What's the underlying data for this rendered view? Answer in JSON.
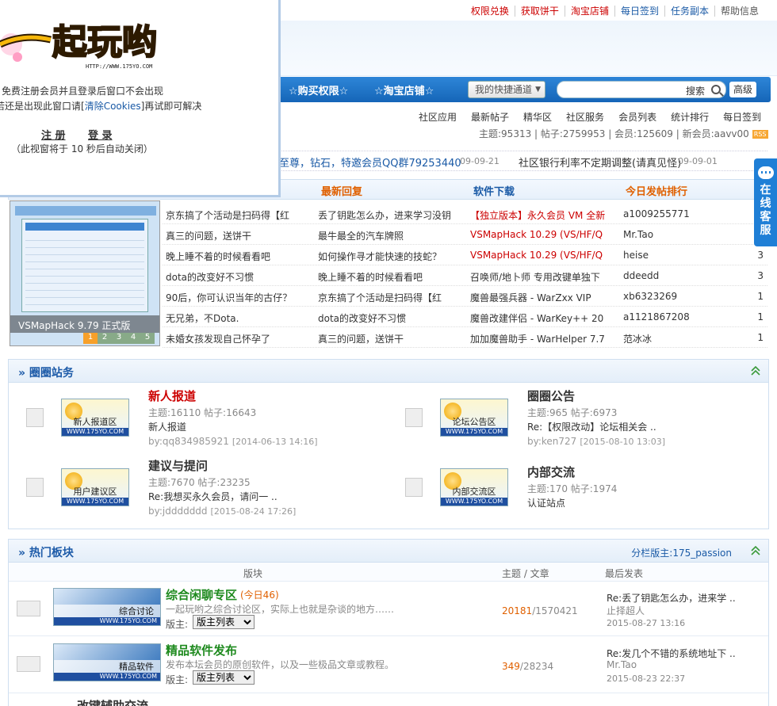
{
  "top_links": [
    {
      "label": "权限兑换",
      "color": "#cc0000"
    },
    {
      "label": "获取饼干",
      "color": "#cc0000"
    },
    {
      "label": "淘宝店铺",
      "color": "#cc0000"
    },
    {
      "label": "每日签到",
      "color": "#1a5aa6"
    },
    {
      "label": "任务副本",
      "color": "#1a5aa6"
    },
    {
      "label": "帮助信息",
      "color": "#555555"
    }
  ],
  "popup": {
    "logo_text": "一起玩哟",
    "logo_url": "HTTP://WWW.175YO.COM",
    "line1": "免费注册会员并且登录后窗口不会出现",
    "line2_pre": "若还是出现此窗口请[",
    "line2_link": "清除Cookies",
    "line2_post": "]再试即可解决",
    "register": "注 册",
    "login": "登 录",
    "countdown": "（此视窗将于 10 秒后自动关闭）"
  },
  "nav": {
    "link1": "☆购买权限☆",
    "link2": "☆淘宝店铺☆",
    "quick": "我的快捷通道",
    "search_label": "搜索",
    "advanced": "高级"
  },
  "community_links": [
    "社区应用",
    "最新帖子",
    "精华区",
    "社区服务",
    "会员列表",
    "统计排行",
    "每日签到"
  ],
  "stats": {
    "text": "主题:95313 | 帖子:2759953 | 会员:125609 | 新会员:aavv00",
    "rss": "RSS"
  },
  "announcements": [
    {
      "text": "至尊，钻石，特邀会员QQ群79253440",
      "date": "09-09-21"
    },
    {
      "text": "社区银行利率不定期调整(请真见怪)",
      "date": "09-09-01"
    }
  ],
  "four_cols": {
    "headers": [
      {
        "label": "最新回复",
        "color": "#e06000"
      },
      {
        "label": "软件下载",
        "color": "#1a5aa6"
      },
      {
        "label": "今日发帖排行",
        "color": "#e06000"
      }
    ],
    "screenshot_caption": "VSMapHack 9.79 正式版",
    "screenshot_pages": [
      "1",
      "2",
      "3",
      "4",
      "5"
    ],
    "rows": [
      {
        "c1": "京东搞了个活动是扫码得【红",
        "c2": "丢了钥匙怎么办，进来学习没钥",
        "c3": "【独立版本】永久会员 VM 全新",
        "c3red": true,
        "c4": "a1009255771",
        "c5": ""
      },
      {
        "c1": "真三的问题，送饼干",
        "c2": "最牛最全的汽车牌照",
        "c3": "VSMapHack 10.29 (VS/HF/Q",
        "c3red": true,
        "c4": "Mr.Tao",
        "c5": "3"
      },
      {
        "c1": "晚上睡不着的时候看看吧",
        "c2": "如何操作寻才能快速的技蛇？",
        "c3": "VSMapHack 10.29 (VS/HF/Q",
        "c3red": true,
        "c4": "heise",
        "c5": "3"
      },
      {
        "c1": "dota的改变好不习惯",
        "c2": "晚上睡不着的时候看看吧",
        "c3": "召唤师/地卜师 专用改键单独下",
        "c3red": false,
        "c4": "ddeedd",
        "c5": "3"
      },
      {
        "c1": "90后，你可认识当年的古仔？",
        "c2": "京东搞了个活动是扫码得【红",
        "c3": "魔兽最强兵器 - WarZxx VIP",
        "c3red": false,
        "c4": "xb6323269",
        "c5": "1"
      },
      {
        "c1": "无兄弟，不Dota.",
        "c2": "dota的改变好不习惯",
        "c3": "魔兽改建伴侣 - WarKey++ 20",
        "c3red": false,
        "c4": "a1121867208",
        "c5": "1"
      },
      {
        "c1": "未婚女孩发现自己怀孕了",
        "c2": "真三的问题，送饼干",
        "c3": "加加魔兽助手 - WarHelper 7.7",
        "c3red": false,
        "c4": "范冰冰",
        "c5": "1"
      }
    ]
  },
  "section1": {
    "title": "» 圈圈站务",
    "forums": [
      {
        "name": "新人报道",
        "name_color": "#cc0000",
        "thumb": "新人报道区",
        "meta": "主题:16110  帖子:16643",
        "desc": "新人报道",
        "by": "by:qq834985921",
        "date": "[2014-06-13 14:16]"
      },
      {
        "name": "圈圈公告",
        "name_color": "#333333",
        "thumb": "论坛公告区",
        "meta": "主题:965  帖子:6973",
        "desc": "Re:【权限改动】论坛相关会 ..",
        "by": "by:ken727",
        "date": "[2015-08-10 13:03]"
      },
      {
        "name": "建议与提问",
        "name_color": "#333333",
        "thumb": "用户建议区",
        "meta": "主题:7670  帖子:23235",
        "desc": "Re:我想买永久会员，请问一  ..",
        "by": "by:jddddddd",
        "date": "[2015-08-24 17:26]"
      },
      {
        "name": "内部交流",
        "name_color": "#333333",
        "thumb": "内部交流区",
        "meta": "主题:170  帖子:1974",
        "desc": "认证站点",
        "by": "",
        "date": ""
      }
    ],
    "thumb_url": "WWW.175YO.COM"
  },
  "section2": {
    "title": "» 热门板块",
    "moderator": "分栏版主:175_passion",
    "col_board": "版块",
    "col_topics": "主题 / 文章",
    "col_last": "最后发表",
    "mod_label": "版主:",
    "mod_select": "版主列表",
    "forums": [
      {
        "name": "综合闲聊专区",
        "today": "(今日46)",
        "thumb": "综合讨论",
        "desc": "一起玩哟之综合讨论区，实际上也就是杂谈的地方……",
        "topics": "20181",
        "posts": "/1570421",
        "last_title": "Re:丢了钥匙怎么办，进来学  ..",
        "last_user": "止择超人",
        "last_date": "2015-08-27 13:16"
      },
      {
        "name": "精品软件发布",
        "today": "",
        "thumb": "精品软件",
        "desc": "发布本坛会员的原创软件，以及一些极品文章或教程。",
        "topics": "349",
        "posts": "/28234",
        "last_title": "Re:发几个不错的系统地址下  ..",
        "last_user": "Mr.Tao",
        "last_date": "2015-08-23 22:37"
      }
    ],
    "partial_name": "改键辅助交流"
  },
  "online_service": "在线客服",
  "colors": {
    "accent": "#1a5aa6",
    "nav": "#1565b8",
    "red": "#cc0000",
    "orange": "#e06000",
    "green": "#1e8a1e"
  }
}
